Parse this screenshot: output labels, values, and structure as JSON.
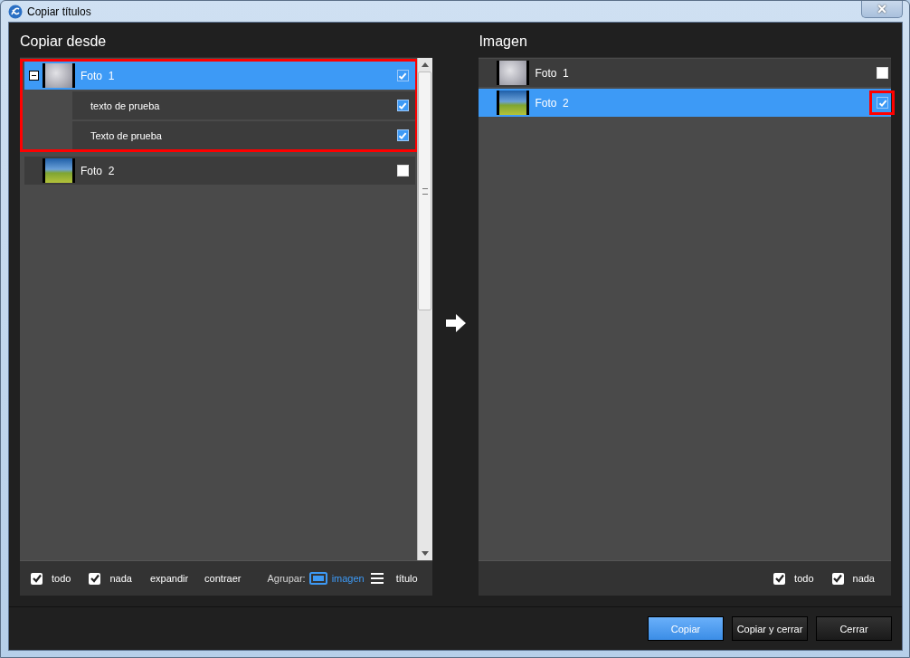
{
  "window": {
    "title": "Copiar títulos",
    "close": "×"
  },
  "source": {
    "title": "Copiar desde",
    "items": [
      {
        "label": "Foto  1",
        "selected": true,
        "checked": true,
        "expanded": true,
        "highlighted": true,
        "children": [
          {
            "label": "texto de prueba",
            "checked": true
          },
          {
            "label": "Texto de prueba",
            "checked": true
          }
        ]
      },
      {
        "label": "Foto  2",
        "selected": false,
        "checked": false,
        "expanded": false,
        "highlighted": false
      }
    ],
    "footer": {
      "checks": [
        {
          "label": "todo",
          "checked": true
        },
        {
          "label": "nada",
          "checked": true
        }
      ],
      "links": [
        "expandir",
        "contraer"
      ],
      "group_label": "Agrupar:",
      "group_options": [
        {
          "label": "imagen",
          "kind": "image",
          "selected": true
        },
        {
          "label": "título",
          "kind": "list",
          "selected": false
        }
      ]
    }
  },
  "target": {
    "title": "Imagen",
    "items": [
      {
        "label": "Foto  1",
        "selected": false,
        "checked": false,
        "highlighted": false
      },
      {
        "label": "Foto  2",
        "selected": true,
        "checked": true,
        "highlighted": true
      }
    ],
    "footer": {
      "checks": [
        {
          "label": "todo",
          "checked": true
        },
        {
          "label": "nada",
          "checked": true
        }
      ]
    }
  },
  "buttons": [
    {
      "label": "Copiar",
      "primary": true
    },
    {
      "label": "Copiar y cerrar",
      "primary": false
    },
    {
      "label": "Cerrar",
      "primary": false
    }
  ]
}
